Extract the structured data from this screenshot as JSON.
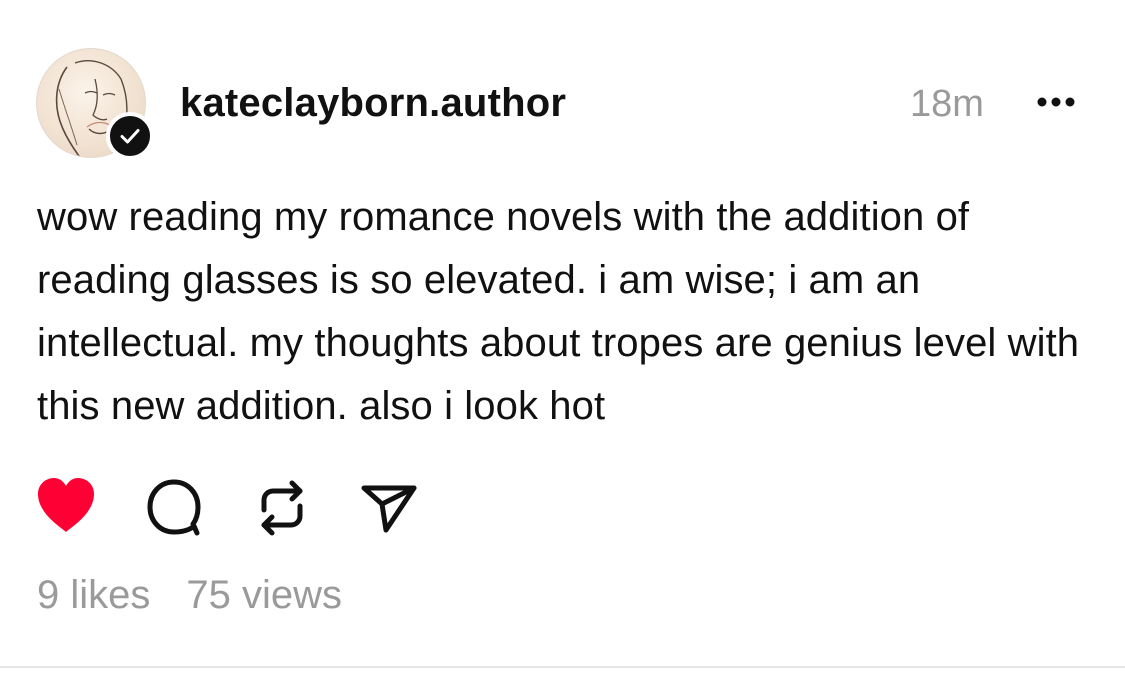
{
  "post": {
    "username": "kateclayborn.author",
    "timestamp": "18m",
    "text": "wow reading my romance novels with the addition of reading glasses is so elevated. i am wise; i am an intellectual. my thoughts about tropes are genius level with this new addition. also i look hot",
    "avatar_icon": "author-portrait-avatar",
    "verified_icon": "verified-check-icon",
    "more_icon": "more-options-icon"
  },
  "actions": {
    "like_icon": "heart-icon",
    "liked": true,
    "like_color": "#ff0034",
    "reply_icon": "comment-icon",
    "repost_icon": "repost-icon",
    "share_icon": "send-icon"
  },
  "stats": {
    "likes": "9 likes",
    "views": "75 views"
  },
  "colors": {
    "text": "#111111",
    "muted": "#9a9a9a",
    "background": "#ffffff"
  }
}
